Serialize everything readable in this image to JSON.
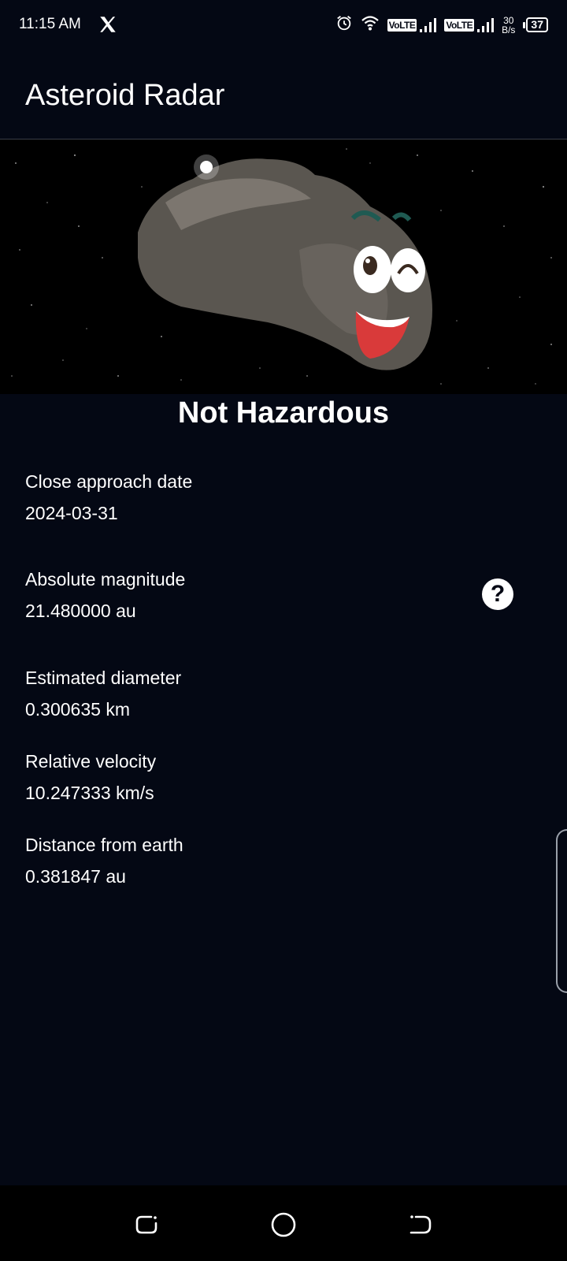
{
  "status_bar": {
    "time": "11:15 AM",
    "network_label_1": "VoLTE",
    "network_label_2": "VoLTE",
    "speed_value": "30",
    "speed_unit": "B/s",
    "battery": "37"
  },
  "app_bar": {
    "title": "Asteroid Radar"
  },
  "hero": {
    "icon": "smiling-asteroid-image"
  },
  "status_heading": "Not Hazardous",
  "details": {
    "close_approach_label": "Close approach date",
    "close_approach_value": "2024-03-31",
    "absolute_magnitude_label": "Absolute magnitude",
    "absolute_magnitude_value": "21.480000 au",
    "estimated_diameter_label": "Estimated diameter",
    "estimated_diameter_value": "0.300635 km",
    "relative_velocity_label": "Relative velocity",
    "relative_velocity_value": "10.247333 km/s",
    "distance_label": "Distance from earth",
    "distance_value": "0.381847 au"
  },
  "help_button": {
    "symbol": "?"
  },
  "colors": {
    "background": "#040814",
    "text": "#ffffff"
  }
}
